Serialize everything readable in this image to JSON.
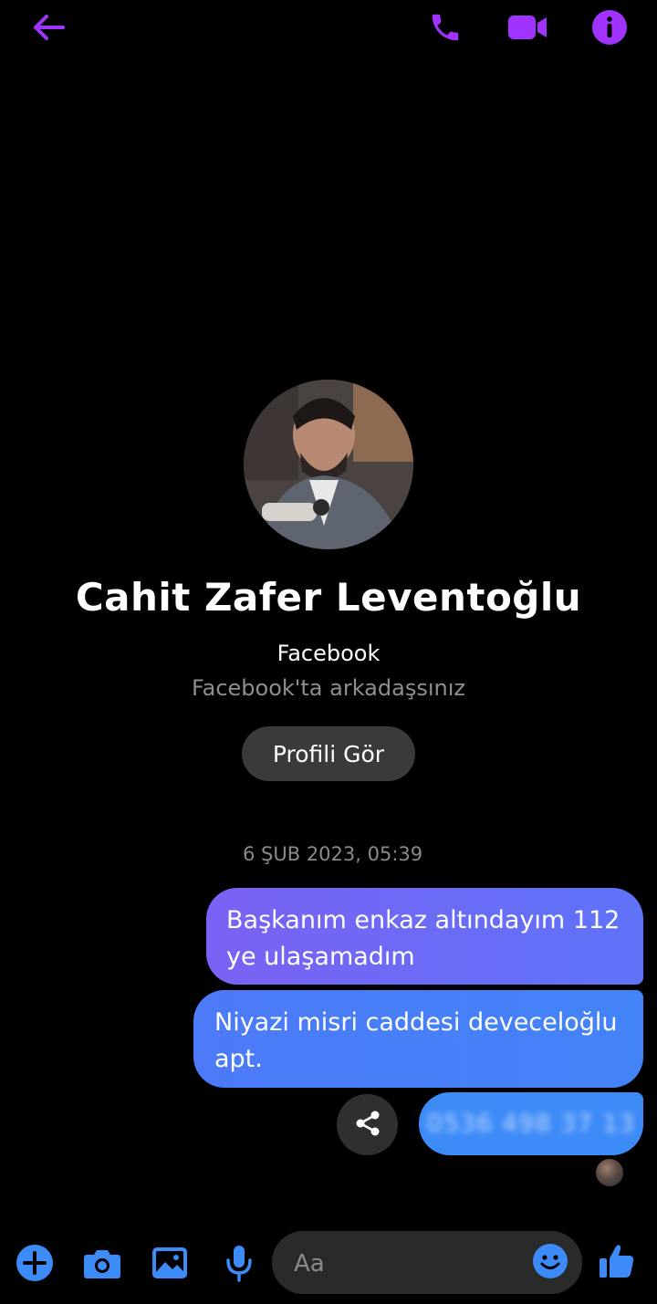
{
  "colors": {
    "header_icon": "#a033ff",
    "accent_blue": "#3d8bf7",
    "background": "#000000"
  },
  "header": {
    "icons": [
      "back-arrow-icon",
      "phone-icon",
      "video-camera-icon",
      "info-icon"
    ]
  },
  "profile": {
    "name": "Cahit Zafer Leventoğlu",
    "network": "Facebook",
    "status": "Facebook'ta arkadaşsınız",
    "view_profile_label": "Profili Gör"
  },
  "conversation": {
    "timestamp": "6 ŞUB 2023, 05:39",
    "messages": [
      {
        "text": "Başkanım enkaz altındayım 112 ye ulaşamadım"
      },
      {
        "text": "Niyazi misri caddesi deveceloğlu apt."
      },
      {
        "text": "0536 498 37 13",
        "blurred": true
      }
    ]
  },
  "composer": {
    "placeholder": "Aa",
    "icons": [
      "plus-circle-icon",
      "camera-icon",
      "image-icon",
      "microphone-icon",
      "emoji-icon",
      "thumbs-up-icon"
    ]
  }
}
